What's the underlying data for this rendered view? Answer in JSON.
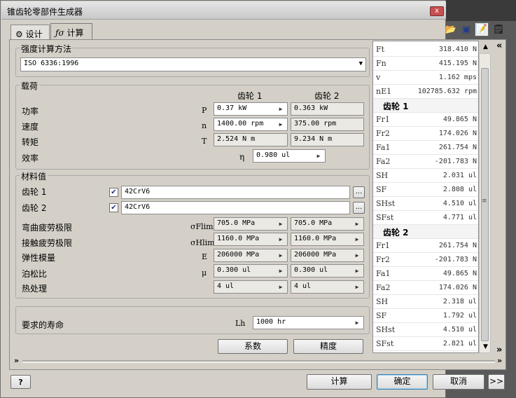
{
  "window": {
    "title": "锥齿轮零部件生成器",
    "close": "x"
  },
  "tabs": [
    {
      "label": "设计"
    },
    {
      "label": "计算"
    }
  ],
  "strength": {
    "title": "强度计算方法",
    "value": "ISO 6336:1996"
  },
  "loads": {
    "title": "载荷",
    "gear1_header": "齿轮 1",
    "gear2_header": "齿轮 2",
    "rows": [
      {
        "label": "功率",
        "symbol": "P",
        "g1": "0.37 kW",
        "g2": "0.363 kW"
      },
      {
        "label": "速度",
        "symbol": "n",
        "g1": "1400.00 rpm",
        "g2": "375.00 rpm"
      },
      {
        "label": "转矩",
        "symbol": "T",
        "g1": "2.524 N m",
        "g2": "9.234 N m"
      }
    ],
    "efficiency": {
      "label": "效率",
      "symbol": "η",
      "value": "0.980 ul"
    }
  },
  "materials": {
    "title": "材料值",
    "gear1": {
      "label": "齿轮 1",
      "value": "42CrV6",
      "browse": "..."
    },
    "gear2": {
      "label": "齿轮 2",
      "value": "42CrV6",
      "browse": "..."
    },
    "rows": [
      {
        "label": "弯曲疲劳极限",
        "symbol": "σFlim",
        "g1": "705.0 MPa",
        "g2": "705.0 MPa"
      },
      {
        "label": "接触疲劳极限",
        "symbol": "σHlim",
        "g1": "1160.0 MPa",
        "g2": "1160.0 MPa"
      },
      {
        "label": "弹性模量",
        "symbol": "E",
        "g1": "206000 MPa",
        "g2": "206000 MPa"
      },
      {
        "label": "泊松比",
        "symbol": "μ",
        "g1": "0.300 ul",
        "g2": "0.300 ul"
      },
      {
        "label": "热处理",
        "symbol": "",
        "g1": "4 ul",
        "g2": "4 ul"
      }
    ]
  },
  "life": {
    "label": "要求的寿命",
    "symbol": "Lh",
    "value": "1000 hr"
  },
  "actions": {
    "factors": "系数",
    "accuracy": "精度"
  },
  "results": {
    "general": [
      {
        "name": "Ft",
        "value": "318.410 N"
      },
      {
        "name": "Fn",
        "value": "415.195 N"
      },
      {
        "name": "v",
        "value": "1.162 mps"
      },
      {
        "name": "nE1",
        "value": "102785.632 rpm"
      }
    ],
    "gear1_header": "齿轮 1",
    "gear1": [
      {
        "name": "Fr1",
        "value": "49.865 N"
      },
      {
        "name": "Fr2",
        "value": "174.026 N"
      },
      {
        "name": "Fa1",
        "value": "261.754 N"
      },
      {
        "name": "Fa2",
        "value": "-201.783 N"
      },
      {
        "name": "SH",
        "value": "2.031 ul"
      },
      {
        "name": "SF",
        "value": "2.808 ul"
      },
      {
        "name": "SHst",
        "value": "4.510 ul"
      },
      {
        "name": "SFst",
        "value": "4.771 ul"
      }
    ],
    "gear2_header": "齿轮 2",
    "gear2": [
      {
        "name": "Fr1",
        "value": "261.754 N"
      },
      {
        "name": "Fr2",
        "value": "-201.783 N"
      },
      {
        "name": "Fa1",
        "value": "49.865 N"
      },
      {
        "name": "Fa2",
        "value": "174.026 N"
      },
      {
        "name": "SH",
        "value": "2.318 ul"
      },
      {
        "name": "SF",
        "value": "1.792 ul"
      },
      {
        "name": "SHst",
        "value": "4.510 ul"
      },
      {
        "name": "SFst",
        "value": "2.821 ul"
      }
    ]
  },
  "footer": {
    "help": "?",
    "calculate": "计算",
    "ok": "确定",
    "cancel": "取消",
    "more": ">>"
  }
}
